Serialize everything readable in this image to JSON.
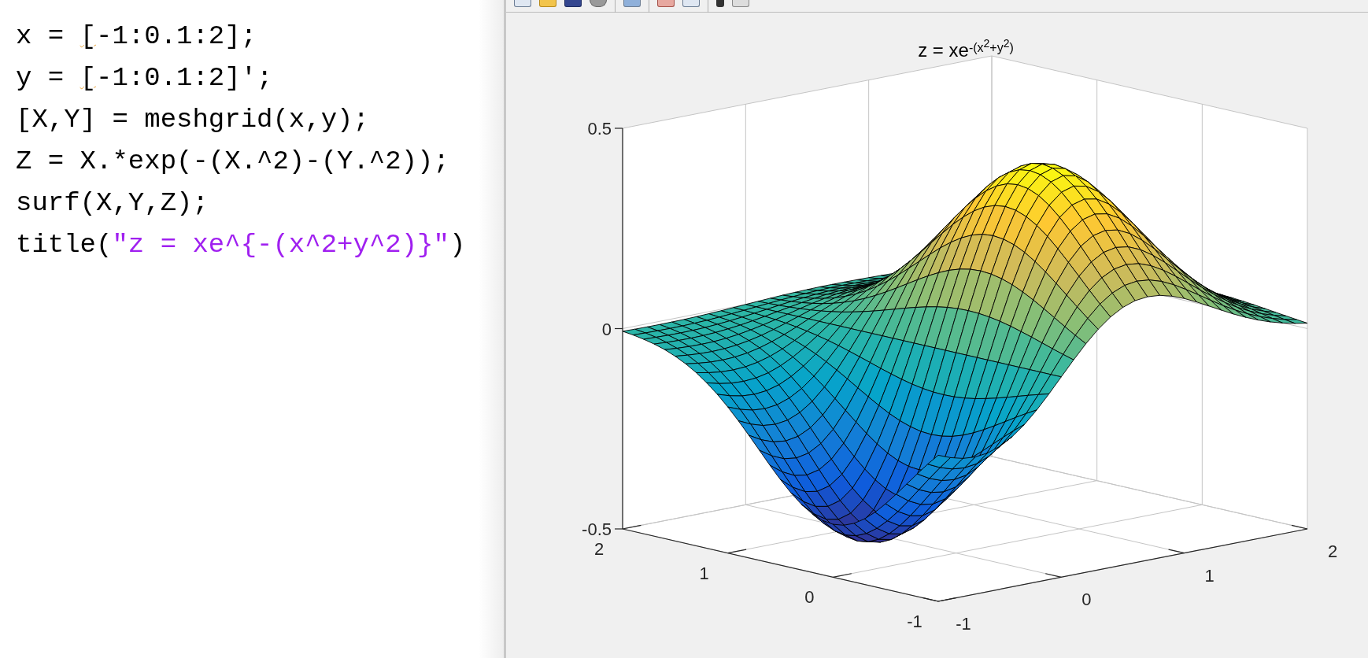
{
  "editor": {
    "lines": [
      [
        {
          "kind": "plain",
          "text": "x = "
        },
        {
          "kind": "warning",
          "text": "["
        },
        {
          "kind": "plain",
          "text": "-1:0.1:2];"
        }
      ],
      [
        {
          "kind": "plain",
          "text": "y = "
        },
        {
          "kind": "warning",
          "text": "["
        },
        {
          "kind": "plain",
          "text": "-1:0.1:2]';"
        }
      ],
      [
        {
          "kind": "plain",
          "text": "[X,Y] = meshgrid(x,y);"
        }
      ],
      [
        {
          "kind": "plain",
          "text": "Z = X.*exp(-(X.^2)-(Y.^2));"
        }
      ],
      [
        {
          "kind": "plain",
          "text": "surf(X,Y,Z);"
        }
      ],
      [
        {
          "kind": "plain",
          "text": "title("
        },
        {
          "kind": "string",
          "text": "\"z = xe^{-(x^2+y^2)}\""
        },
        {
          "kind": "plain",
          "text": ")"
        }
      ]
    ]
  },
  "figure": {
    "title": [
      {
        "kind": "base",
        "text": "z = xe"
      },
      {
        "kind": "sup",
        "text": "-(x"
      },
      {
        "kind": "supsup",
        "text": "2"
      },
      {
        "kind": "sup",
        "text": "+y"
      },
      {
        "kind": "supsup",
        "text": "2"
      },
      {
        "kind": "sup",
        "text": ")"
      }
    ],
    "z_ticks": [
      "0.5",
      "0",
      "-0.5"
    ],
    "x_ticks": [
      "-1",
      "0",
      "1",
      "2"
    ],
    "y_ticks": [
      "-1",
      "0",
      "1",
      "2"
    ]
  }
}
